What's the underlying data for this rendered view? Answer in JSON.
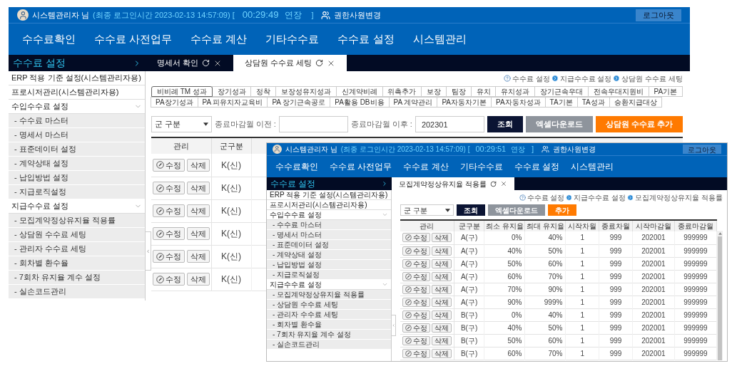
{
  "windows": [
    {
      "user": {
        "name": "시스템관리자 님",
        "login": "(최종 로그인시간 2023-02-13 14:57:09) [",
        "timer": "00:29:49",
        "extend": "연장",
        "bracket": "]",
        "switch_user": "권한사원변경"
      },
      "logout": "로그아웃",
      "nav": [
        "수수료확인",
        "수수료 사전업무",
        "수수료 계산",
        "기타수수료",
        "수수료 설정",
        "시스템관리"
      ],
      "section_title": "수수료 설정",
      "tabs": [
        {
          "label": "명세서 확인",
          "selected": false
        },
        {
          "label": "상담원 수수료 세팅",
          "selected": true
        }
      ],
      "sidebar": [
        {
          "label": "ERP 적용 기준 설정(시스템관리자용)"
        },
        {
          "label": "프로시저관리(시스템관리자용)"
        },
        {
          "label": "수입수수료 설정",
          "expanded": true,
          "children": [
            {
              "label": "- 수수료 마스터"
            },
            {
              "label": "- 명세서 마스터"
            },
            {
              "label": "- 표준데이터 설정"
            },
            {
              "label": "- 계약상태 설정"
            },
            {
              "label": "- 납입방법 설정"
            },
            {
              "label": "- 지급로직설정"
            }
          ]
        },
        {
          "label": "지급수수료 설정",
          "expanded": true,
          "children": [
            {
              "label": "- 모집계약정상유지율 적용률"
            },
            {
              "label": "- 상담원 수수료 세팅"
            },
            {
              "label": "- 관리자 수수료 세팅"
            },
            {
              "label": "- 회차별 환수율"
            },
            {
              "label": "- 7회차 유지율 계수 설정"
            },
            {
              "label": "- 실손코드관리"
            }
          ]
        }
      ],
      "breadcrumb": [
        "수수료 설정",
        "지급수수료 설정",
        "상담원 수수료 세팅"
      ],
      "fee_tabs": [
        [
          {
            "label": "비비례 TM 성과",
            "selected": true
          },
          {
            "label": "장기성과",
            "selected": false
          },
          {
            "label": "정착",
            "selected": false
          },
          {
            "label": "보장성유지성과",
            "selected": false
          },
          {
            "label": "신계약비례",
            "selected": false
          },
          {
            "label": "위촉추가",
            "selected": false
          },
          {
            "label": "보장",
            "selected": false
          },
          {
            "label": "팀장",
            "selected": false
          },
          {
            "label": "유치",
            "selected": false
          },
          {
            "label": "유치성과",
            "selected": false
          },
          {
            "label": "장기근속우대",
            "selected": false
          },
          {
            "label": "전속우대지원비",
            "selected": false
          },
          {
            "label": "PA기본",
            "selected": false
          }
        ],
        [
          {
            "label": "PA장기성과",
            "selected": false
          },
          {
            "label": "PA 피유치자교육비",
            "selected": false
          },
          {
            "label": "PA 장기근속공로",
            "selected": false
          },
          {
            "label": "PA활용 DB비용",
            "selected": false
          },
          {
            "label": "PA 계약관리",
            "selected": false
          },
          {
            "label": "PA자동차기본",
            "selected": false
          },
          {
            "label": "PA자동차성과",
            "selected": false
          },
          {
            "label": "TA기본",
            "selected": false
          },
          {
            "label": "TA성과",
            "selected": false
          },
          {
            "label": "승환지급대상",
            "selected": false
          }
        ]
      ],
      "filter": {
        "select": "군 구분",
        "fields": [
          {
            "label": "종료마감월 이전 :"
          },
          {
            "label": "종료마감월 이후 :",
            "value": "202301"
          }
        ],
        "buttons": [
          {
            "label": "조회",
            "kind": "search"
          },
          {
            "label": "엑셀다운로드",
            "kind": "excel"
          },
          {
            "label": "상담원 수수료 추가",
            "kind": "add"
          }
        ]
      },
      "table": {
        "columns": [
          {
            "label": "관리"
          },
          {
            "label": "군구분"
          }
        ],
        "rows": [
          {
            "cells": [
              [
                "수정",
                "삭제"
              ],
              "K(신)"
            ]
          },
          {
            "cells": [
              [
                "수정",
                "삭제"
              ],
              "K(신)"
            ]
          },
          {
            "cells": [
              [
                "수정",
                "삭제"
              ],
              "K(신)"
            ]
          },
          {
            "cells": [
              [
                "수정",
                "삭제"
              ],
              "K(신)"
            ]
          },
          {
            "cells": [
              [
                "수정",
                "삭제"
              ],
              "K(신)"
            ]
          },
          {
            "cells": [
              [
                "수정",
                "삭제"
              ],
              "K(신)"
            ]
          }
        ]
      }
    },
    {
      "user": {
        "name": "시스템관리자 님",
        "login": "(최종 로그인시간 2023-02-13 14:57:09) [",
        "timer": "00:29:51",
        "extend": "연장",
        "bracket": "]",
        "switch_user": "권한사원변경"
      },
      "logout": "로그아웃",
      "nav": [
        "수수료확인",
        "수수료 사전업무",
        "수수료 계산",
        "기타수수료",
        "수수료 설정",
        "시스템관리"
      ],
      "section_title": "수수료 설정",
      "tabs": [
        {
          "label": "모집계약정상유지율 적용률",
          "selected": true
        }
      ],
      "sidebar": [
        {
          "label": "ERP 적용 기준 설정(시스템관리자용)"
        },
        {
          "label": "프로시저관리(시스템관리자용)"
        },
        {
          "label": "수입수수료 설정",
          "expanded": true,
          "children": [
            {
              "label": "- 수수료 마스터"
            },
            {
              "label": "- 명세서 마스터"
            },
            {
              "label": "- 표준데이터 설정"
            },
            {
              "label": "- 계약상태 설정"
            },
            {
              "label": "- 납입방법 설정"
            },
            {
              "label": "- 지급로직설정"
            }
          ]
        },
        {
          "label": "지급수수료 설정",
          "expanded": true,
          "children": [
            {
              "label": "- 모집계약정상유지율 적용률"
            },
            {
              "label": "- 상담원 수수료 세팅"
            },
            {
              "label": "- 관리자 수수료 세팅"
            },
            {
              "label": "- 회차별 환수율"
            },
            {
              "label": "- 7회차 유지율 계수 설정"
            },
            {
              "label": "- 실손코드관리"
            }
          ]
        }
      ],
      "breadcrumb": [
        "수수료 설정",
        "지급수수료 설정",
        "모집계약정상유지율 적용률"
      ],
      "filter": {
        "select": "군 구분",
        "buttons": [
          {
            "label": "조회",
            "kind": "search"
          },
          {
            "label": "엑셀다운로드",
            "kind": "excel"
          },
          {
            "label": "추가",
            "kind": "add"
          }
        ]
      },
      "table": {
        "columns": [
          {
            "label": "관리"
          },
          {
            "label": "군구분"
          },
          {
            "label": "최소 유지율",
            "kind": "percent"
          },
          {
            "label": "최대 유지율",
            "kind": "percent"
          },
          {
            "label": "시작차월"
          },
          {
            "label": "종료차월"
          },
          {
            "label": "시작마감월"
          },
          {
            "label": "종료마감월"
          }
        ],
        "rows": [
          {
            "cells": [
              [
                "수정",
                "삭제"
              ],
              "A(구)",
              "0%",
              "40%",
              "1",
              "999",
              "202001",
              "999999"
            ]
          },
          {
            "cells": [
              [
                "수정",
                "삭제"
              ],
              "A(구)",
              "40%",
              "50%",
              "1",
              "999",
              "202001",
              "999999"
            ]
          },
          {
            "cells": [
              [
                "수정",
                "삭제"
              ],
              "A(구)",
              "50%",
              "60%",
              "1",
              "999",
              "202001",
              "999999"
            ]
          },
          {
            "cells": [
              [
                "수정",
                "삭제"
              ],
              "A(구)",
              "60%",
              "70%",
              "1",
              "999",
              "202001",
              "999999"
            ]
          },
          {
            "cells": [
              [
                "수정",
                "삭제"
              ],
              "A(구)",
              "70%",
              "90%",
              "1",
              "999",
              "202001",
              "999999"
            ]
          },
          {
            "cells": [
              [
                "수정",
                "삭제"
              ],
              "A(구)",
              "90%",
              "999%",
              "1",
              "999",
              "202001",
              "999999"
            ]
          },
          {
            "cells": [
              [
                "수정",
                "삭제"
              ],
              "B(구)",
              "0%",
              "40%",
              "1",
              "999",
              "202001",
              "999999"
            ]
          },
          {
            "cells": [
              [
                "수정",
                "삭제"
              ],
              "B(구)",
              "40%",
              "50%",
              "1",
              "999",
              "202001",
              "999999"
            ]
          },
          {
            "cells": [
              [
                "수정",
                "삭제"
              ],
              "B(구)",
              "50%",
              "60%",
              "1",
              "999",
              "202001",
              "999999"
            ]
          },
          {
            "cells": [
              [
                "수정",
                "삭제"
              ],
              "B(구)",
              "60%",
              "70%",
              "1",
              "999",
              "202001",
              "999999"
            ]
          }
        ]
      }
    }
  ]
}
